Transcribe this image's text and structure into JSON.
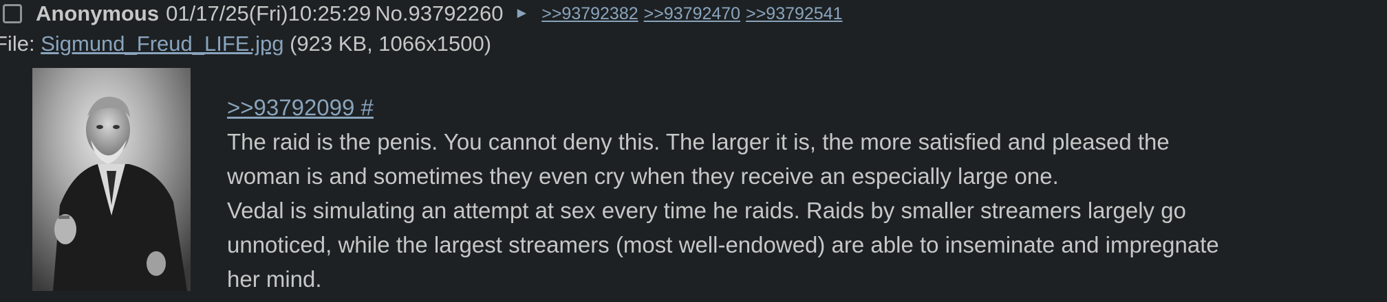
{
  "post": {
    "name": "Anonymous",
    "datetime": "01/17/25(Fri)10:25:29",
    "post_number": "No.93792260",
    "reply_arrow": "►",
    "backlinks": [
      ">>93792382",
      ">>93792470",
      ">>93792541"
    ],
    "file": {
      "label": "File: ",
      "filename": "Sigmund_Freud_LIFE.jpg",
      "meta": " (923 KB, 1066x1500)"
    },
    "quote_link": ">>93792099 #",
    "body_lines": [
      "The raid is the penis. You cannot deny this. The larger it is, the more satisfied and pleased the",
      "woman is and sometimes they even cry when they receive an especially large one.",
      "Vedal is simulating an attempt at sex every time he raids. Raids by smaller streamers largely go",
      "unnoticed, while the largest streamers (most well-endowed) are able to inseminate and impregnate",
      "her mind."
    ]
  },
  "colors": {
    "background": "#1d2123",
    "text": "#c5c8c6",
    "link": "#8aa4bd"
  }
}
